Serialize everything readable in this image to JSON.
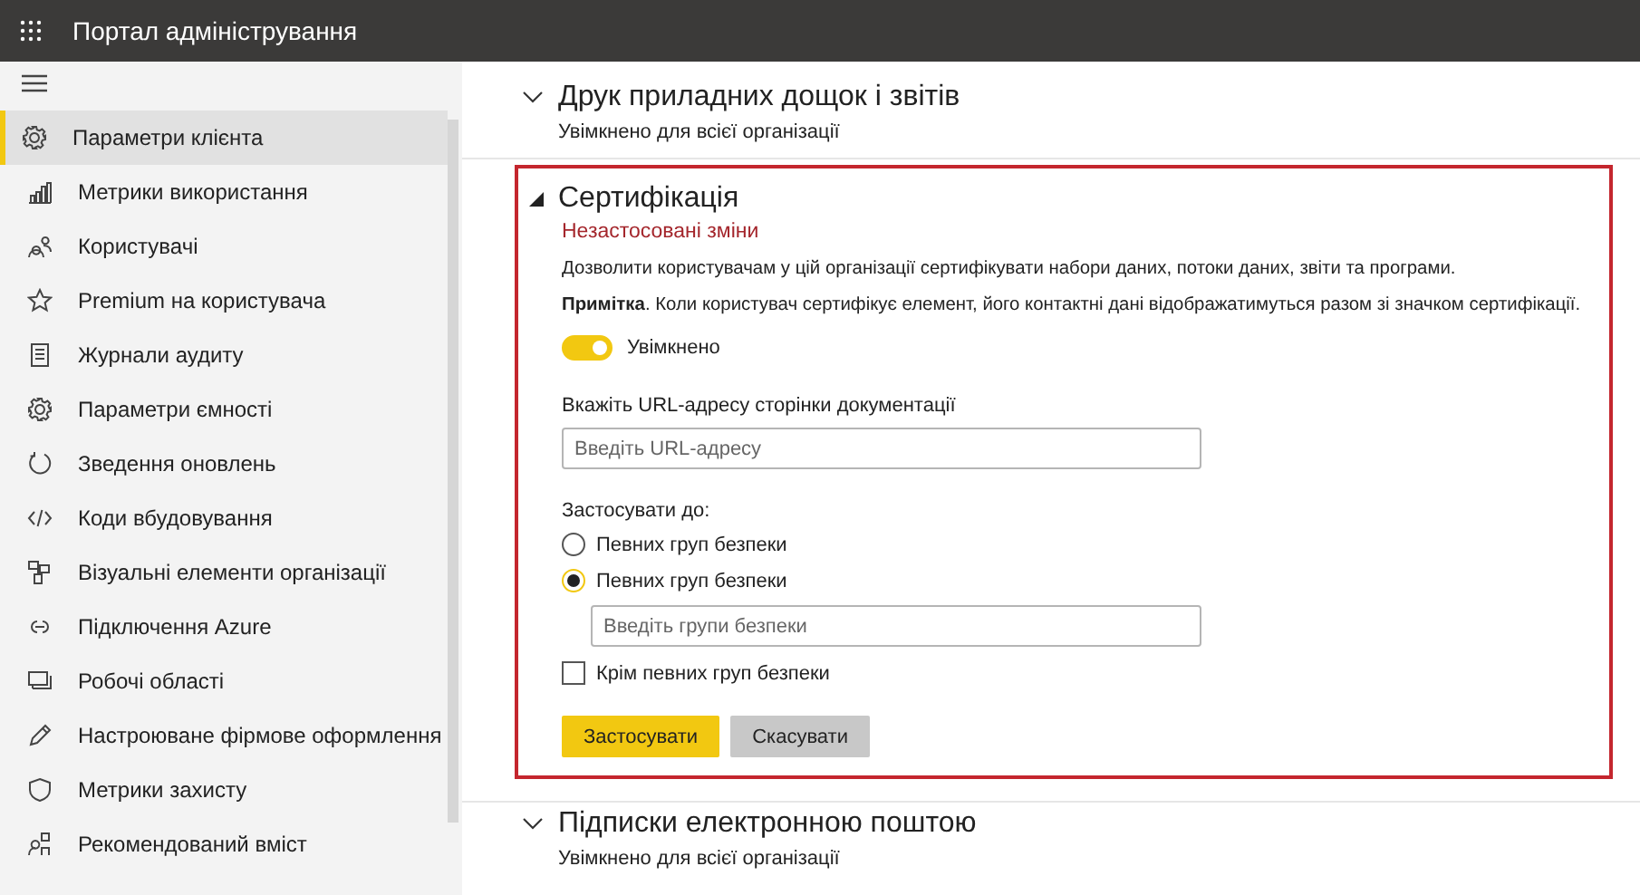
{
  "header": {
    "title": "Портал адміністрування"
  },
  "sidebar": {
    "items": [
      {
        "label": "Параметри клієнта",
        "selected": true
      },
      {
        "label": "Метрики використання",
        "selected": false
      },
      {
        "label": "Користувачі",
        "selected": false
      },
      {
        "label": "Premium на користувача",
        "selected": false
      },
      {
        "label": "Журнали аудиту",
        "selected": false
      },
      {
        "label": "Параметри ємності",
        "selected": false
      },
      {
        "label": "Зведення оновлень",
        "selected": false
      },
      {
        "label": "Коди вбудовування",
        "selected": false
      },
      {
        "label": "Візуальні елементи організації",
        "selected": false
      },
      {
        "label": "Підключення Azure",
        "selected": false
      },
      {
        "label": "Робочі області",
        "selected": false
      },
      {
        "label": "Настроюване фірмове оформлення",
        "selected": false
      },
      {
        "label": "Метрики захисту",
        "selected": false
      },
      {
        "label": "Рекомендований вміст",
        "selected": false
      }
    ]
  },
  "sections": [
    {
      "kind": "collapsed",
      "title": "Друк приладних дощок і звітів",
      "subtitle": "Увімкнено для всієї організації"
    },
    {
      "kind": "expanded",
      "highlighted": true,
      "title": "Сертифікація",
      "warning": "Незастосовані зміни",
      "description": "Дозволити користувачам у цій організації сертифікувати набори даних, потоки даних, звіти та програми.",
      "note": "**Примітка**. Коли користувач сертифікує елемент, його контактні дані відображатимуться разом зі значком сертифікації.",
      "toggle": {
        "on": true,
        "label": "Увімкнено"
      },
      "url_field": {
        "label": "Вкажіть URL-адресу сторінки документації",
        "placeholder": "Введіть URL-адресу"
      },
      "apply_to": {
        "label": "Застосувати до:",
        "options": [
          {
            "label": "Певних груп безпеки",
            "selected": false
          },
          {
            "label": "Певних груп безпеки",
            "selected": true
          }
        ],
        "groups_field": {
          "placeholder": "Введіть групи безпеки"
        }
      },
      "exclude": {
        "label": "Крім певних груп безпеки",
        "checked": false
      },
      "buttons": [
        {
          "label": "Застосувати",
          "kind": "primary"
        },
        {
          "label": "Скасувати",
          "kind": "secondary"
        }
      ]
    },
    {
      "kind": "collapsed",
      "title": "Підписки електронною поштою",
      "subtitle": "Увімкнено для всієї організації"
    }
  ]
}
